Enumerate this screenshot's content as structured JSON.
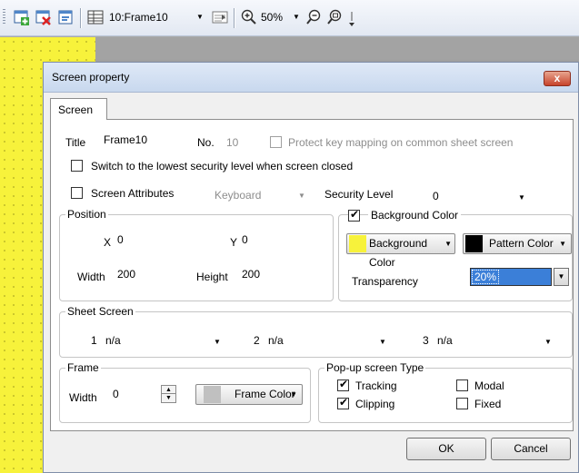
{
  "toolbar": {
    "frame_selector": "10:Frame10",
    "zoom": "50%",
    "icons": [
      "add-screen-icon",
      "delete-screen-icon",
      "screen-properties-icon",
      "frame-list-icon",
      "frame-layout-icon",
      "zoom-in-icon",
      "zoom-out-icon",
      "zoom-fit-icon"
    ]
  },
  "dialog": {
    "title": "Screen property",
    "close_label": "x",
    "tab_label": "Screen",
    "title_label": "Title",
    "title_value": "Frame10",
    "no_label": "No.",
    "no_value": "10",
    "protect_label": "Protect key mapping on common sheet screen",
    "protect_checked": false,
    "switch_security_label": "Switch to the lowest security level when screen closed",
    "switch_security_checked": false,
    "screen_attributes_label": "Screen Attributes",
    "screen_attributes_checked": false,
    "screen_attributes_value": "Keyboard",
    "security_level_label": "Security Level",
    "security_level_value": "0",
    "position": {
      "group_label": "Position",
      "x_label": "X",
      "x_value": "0",
      "y_label": "Y",
      "y_value": "0",
      "width_label": "Width",
      "width_value": "200",
      "height_label": "Height",
      "height_value": "200"
    },
    "background": {
      "group_label": "Background Color",
      "checked": true,
      "bg_color_button": "Background Color",
      "bg_color": "#f7f23b",
      "pattern_color_button": "Pattern Color",
      "pattern_color": "#000000",
      "transparency_label": "Transparency",
      "transparency_value": "20%"
    },
    "sheet_screen": {
      "group_label": "Sheet Screen",
      "items": [
        {
          "num": "1",
          "value": "n/a"
        },
        {
          "num": "2",
          "value": "n/a"
        },
        {
          "num": "3",
          "value": "n/a"
        }
      ]
    },
    "frame": {
      "group_label": "Frame",
      "width_label": "Width",
      "width_value": "0",
      "frame_color_button": "Frame Color",
      "frame_color": "#c0c0c0"
    },
    "popup": {
      "group_label": "Pop-up screen Type",
      "tracking_label": "Tracking",
      "tracking_checked": true,
      "clipping_label": "Clipping",
      "clipping_checked": true,
      "modal_label": "Modal",
      "modal_checked": false,
      "fixed_label": "Fixed",
      "fixed_checked": false
    },
    "ok_label": "OK",
    "cancel_label": "Cancel"
  },
  "colors": {
    "accent_selection": "#3b7fd8",
    "titlebar": "#c8d8ee"
  }
}
